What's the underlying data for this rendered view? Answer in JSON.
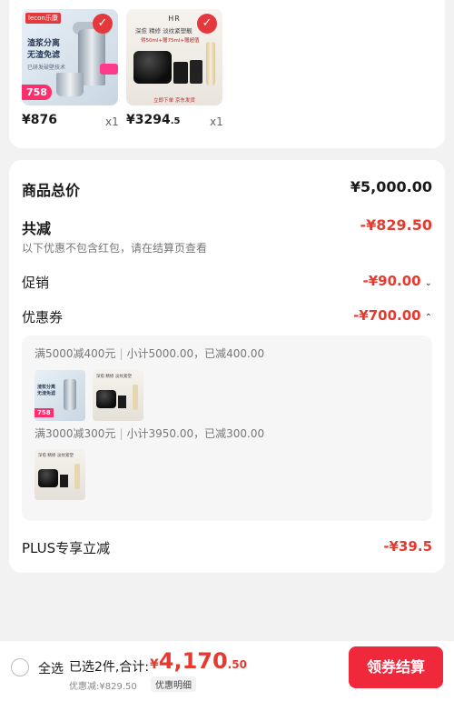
{
  "products": [
    {
      "brand_tag": "lecon乐康",
      "promo_line1": "渣浆分离",
      "promo_line2": "无渣免滤",
      "promo_small": "已研发破壁技术",
      "price_badge": "758",
      "price_int": "¥876",
      "price_dec": "",
      "qty": "x1"
    },
    {
      "header": "HR",
      "promo_line": "深愈 精修 淡纹紧塑靓",
      "promo_sub": "得50ml+赠75ml+赠超值",
      "footer": "立即下单 京东发货",
      "price_int": "¥3294",
      "price_dec": ".5",
      "qty": "x1"
    }
  ],
  "summary": {
    "goods_total_label": "商品总价",
    "goods_total_value": "¥5,000.00",
    "reduce_label": "共减",
    "reduce_value": "-¥829.50",
    "reduce_note": "以下优惠不包含红包，请在结算页查看",
    "promo_label": "促销",
    "promo_value": "-¥90.00",
    "coupon_label": "优惠券",
    "coupon_value": "-¥700.00",
    "plus_label": "PLUS专享立减",
    "plus_value": "-¥39.5"
  },
  "coupons": [
    {
      "rule": "满5000减400元",
      "detail": "小计5000.00，已减400.00"
    },
    {
      "rule": "满3000减300元",
      "detail": "小计3950.00，已减300.00"
    }
  ],
  "thumbs": {
    "a_text": "渣浆分离\n无渣免滤",
    "a_badge": "758",
    "b_text": "深愈 精修 淡纹紧塑"
  },
  "bottom": {
    "select_all": "全选",
    "selected_text": "已选2件,合计:",
    "total_yen": "¥",
    "total_int": "4,170",
    "total_dec": ".50",
    "discount_text": "优惠减:¥829.50",
    "detail_btn": "优惠明细",
    "checkout_btn": "领券结算"
  },
  "colors": {
    "accent_red": "#e63a2e",
    "checkout_red": "#f0283c",
    "price_badge_pink": "#ff2f6d"
  },
  "icons": {
    "check": "check-icon",
    "chevron_down": "chevron-down-icon",
    "chevron_up": "chevron-up-icon",
    "radio": "radio-unchecked-icon"
  }
}
